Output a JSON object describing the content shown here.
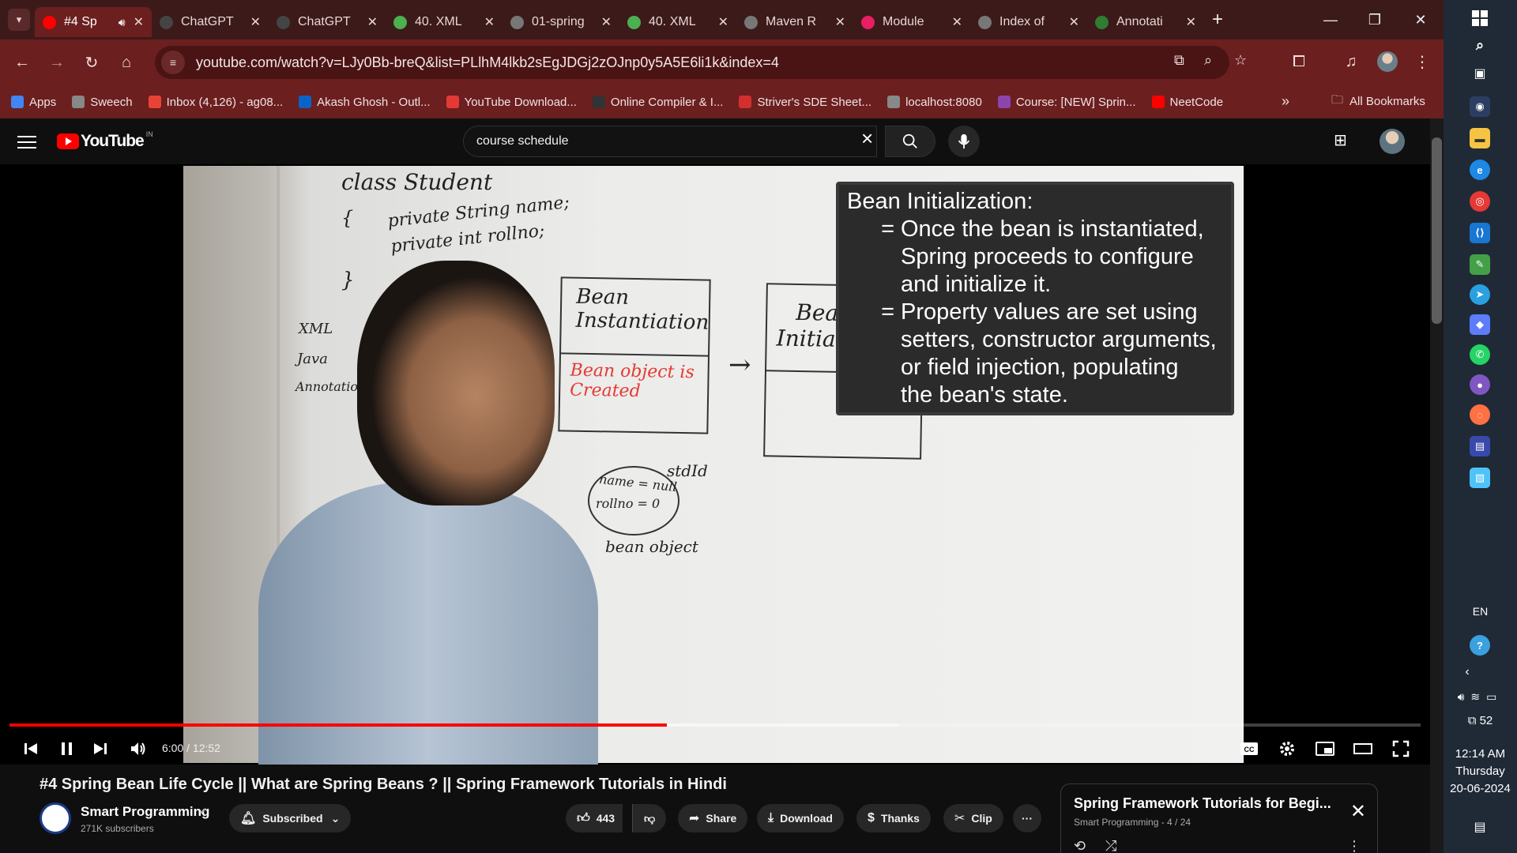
{
  "browser": {
    "tabs": [
      {
        "title": "#4 Sp",
        "active": true,
        "favicon": "youtube-icon",
        "color": "#ff0000"
      },
      {
        "title": "ChatGPT",
        "active": false,
        "favicon": "chatgpt-icon",
        "color": "#444444"
      },
      {
        "title": "ChatGPT",
        "active": false,
        "favicon": "chatgpt-icon",
        "color": "#444444"
      },
      {
        "title": "40. XML",
        "active": false,
        "favicon": "leaf-icon",
        "color": "#4caf50"
      },
      {
        "title": "01-spring",
        "active": false,
        "favicon": "globe-icon",
        "color": "#777777"
      },
      {
        "title": "40. XML",
        "active": false,
        "favicon": "leaf-icon",
        "color": "#4caf50"
      },
      {
        "title": "Maven R",
        "active": false,
        "favicon": "globe-icon",
        "color": "#777777"
      },
      {
        "title": "Module",
        "active": false,
        "favicon": "module-icon",
        "color": "#e91e63"
      },
      {
        "title": "Index of",
        "active": false,
        "favicon": "globe-icon",
        "color": "#777777"
      },
      {
        "title": "Annotati",
        "active": false,
        "favicon": "annotation-icon",
        "color": "#2e7d32"
      }
    ],
    "url": "youtube.com/watch?v=LJy0Bb-breQ&list=PLlhM4lkb2sEgJDGj2zOJnp0y5A5E6li1k&index=4",
    "bookmarks": [
      {
        "label": "Apps",
        "icon": "apps-grid-icon",
        "color": "#4285f4"
      },
      {
        "label": "Sweech",
        "icon": "globe-icon",
        "color": "#888888"
      },
      {
        "label": "Inbox (4,126) - ag08...",
        "icon": "gmail-icon",
        "color": "#ea4335"
      },
      {
        "label": "Akash Ghosh - Outl...",
        "icon": "outlook-icon",
        "color": "#0a64c8"
      },
      {
        "label": "YouTube Download...",
        "icon": "download-icon",
        "color": "#e53935"
      },
      {
        "label": "Online Compiler & I...",
        "icon": "cc-icon",
        "color": "#333333"
      },
      {
        "label": "Striver's SDE Sheet...",
        "icon": "tuf-icon",
        "color": "#d32f2f"
      },
      {
        "label": "localhost:8080",
        "icon": "globe-icon",
        "color": "#888888"
      },
      {
        "label": "Course: [NEW] Sprin...",
        "icon": "udemy-icon",
        "color": "#8e44ad"
      },
      {
        "label": "NeetCode",
        "icon": "youtube-icon",
        "color": "#ff0000"
      }
    ],
    "bookmarks_all": "All Bookmarks",
    "accent": "#6b1f1f"
  },
  "youtube": {
    "region": "IN",
    "search_value": "course schedule",
    "video": {
      "title": "#4 Spring Bean Life Cycle || What are Spring Beans ? || Spring Framework Tutorials in Hindi",
      "time": "6:00 / 12:52",
      "progress_fraction": 0.466,
      "buffered_fraction": 0.63,
      "overlay_heading": "Bean Initialization:",
      "overlay_bullets": [
        [
          "Once the bean is instantiated,",
          "Spring proceeds to configure",
          "and initialize it."
        ],
        [
          "Property values are set using",
          "setters, constructor arguments,",
          "or field injection, populating",
          "the bean's state."
        ]
      ],
      "board_text": {
        "class_line": "class Student",
        "brace": "{",
        "field1": "private String name;",
        "field2": "private int rollno;",
        "close_brace": "}",
        "xml": "XML",
        "java": "Java",
        "annotation": "Annotation",
        "box1_title_1": "Bean",
        "box1_title_2": "Instantiation",
        "box1_body_1": "Bean object is",
        "box1_body_2": "Created",
        "box2_title_1": "Bea",
        "box2_title_2": "Initial",
        "circle_1": "name = null",
        "circle_2": "rollno = 0",
        "stdid": "stdId",
        "bean_object": "bean object",
        "arrow": "→"
      }
    },
    "channel": {
      "name": "Smart Programming",
      "subscribers": "271K subscribers",
      "subscribe_label": "Subscribed"
    },
    "actions": {
      "likes": "443",
      "share": "Share",
      "download": "Download",
      "thanks": "Thanks",
      "clip": "Clip"
    },
    "playlist": {
      "title": "Spring Framework Tutorials for Begi...",
      "channel": "Smart Programming",
      "position": "- 4 / 24"
    }
  },
  "taskbar": {
    "language": "EN",
    "notifications_count": "52",
    "time": "12:14 AM",
    "day": "Thursday",
    "date": "20-06-2024"
  }
}
